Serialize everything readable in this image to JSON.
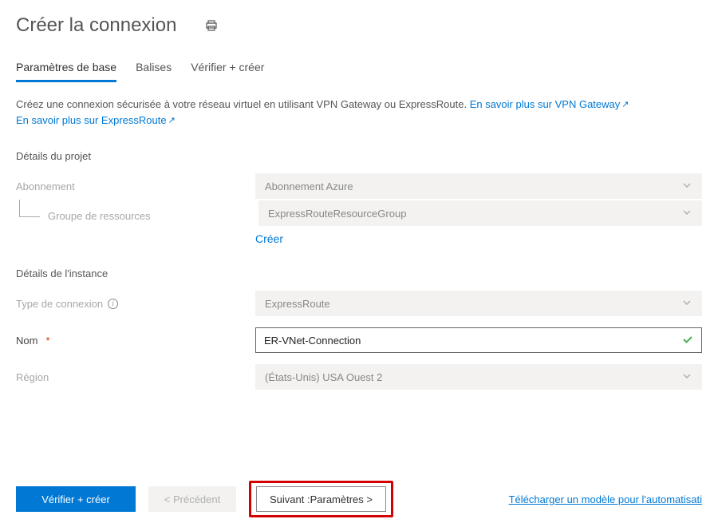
{
  "header": {
    "title": "Créer la connexion"
  },
  "tabs": {
    "basics": "Paramètres de base",
    "tags": "Balises",
    "review": "Vérifier + créer"
  },
  "description": {
    "text": "Créez une connexion sécurisée à votre réseau virtuel en utilisant VPN Gateway ou ExpressRoute. ",
    "link1": "En savoir plus sur VPN Gateway",
    "link2": "En savoir plus sur ExpressRoute"
  },
  "sections": {
    "project": "Détails du projet",
    "instance": "Détails de l'instance"
  },
  "fields": {
    "subscription": {
      "label": "Abonnement",
      "value": "Abonnement Azure"
    },
    "resource_group": {
      "label": "Groupe de ressources",
      "value": "ExpressRouteResourceGroup",
      "create_new": "Créer"
    },
    "connection_type": {
      "label": "Type de connexion",
      "value": "ExpressRoute"
    },
    "name": {
      "label": "Nom",
      "value": "ER-VNet-Connection"
    },
    "region": {
      "label": "Région",
      "value": "(États-Unis) USA Ouest 2"
    }
  },
  "footer": {
    "review_create": "Vérifier + créer",
    "previous": "< Précédent",
    "next": "Suivant :Paramètres >",
    "download": "Télécharger un modèle pour l'automatisati"
  }
}
